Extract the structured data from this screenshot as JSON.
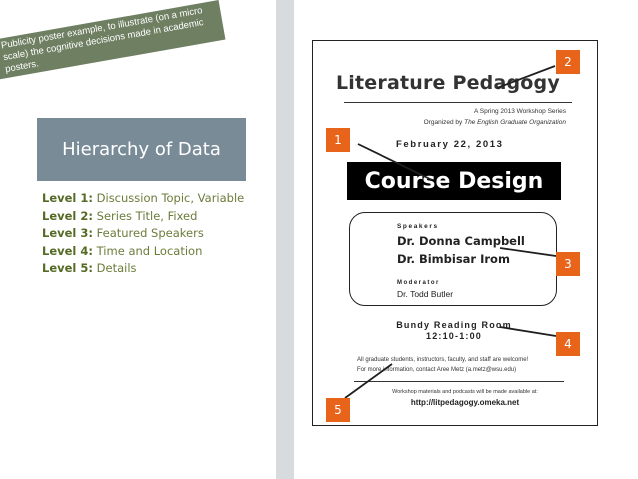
{
  "banner": {
    "text": "Publicity poster example, to illustrate (on a micro scale) the cognitive decisions made in academic posters."
  },
  "hierarchy": {
    "title": "Hierarchy of Data",
    "levels": [
      {
        "label": "Level 1:",
        "text": " Discussion Topic, Variable"
      },
      {
        "label": "Level 2:",
        "text": " Series Title, Fixed"
      },
      {
        "label": "Level 3:",
        "text": " Featured Speakers"
      },
      {
        "label": "Level 4:",
        "text": " Time and Location"
      },
      {
        "label": "Level 5:",
        "text": " Details"
      }
    ]
  },
  "poster": {
    "title": "Literature Pedagogy",
    "subtitle": "A Spring 2013 Workshop Series",
    "organized_prefix": "Organized by ",
    "organized_by": "The English Graduate Organization",
    "date": "February 22, 2013",
    "topic": "Course Design",
    "speakers_label": "Speakers",
    "speakers": [
      "Dr. Donna Campbell",
      "Dr. Bimbisar Irom"
    ],
    "moderator_label": "Moderator",
    "moderator": "Dr. Todd Butler",
    "venue": "Bundy Reading Room",
    "time": "12:10-1:00",
    "details_line1": "All graduate students, instructors, faculty, and staff are welcome!",
    "details_line2": "For more information, contact Aree Metz (a.metz@wsu.edu)",
    "materials": "Workshop materials and podcasts will be made available at:",
    "url": "http://litpedagogy.omeka.net"
  },
  "callouts": [
    "1",
    "2",
    "3",
    "4",
    "5"
  ],
  "colors": {
    "callout": "#e8641b",
    "hierarchy_box": "#7a8b98",
    "banner": "#6f7f62"
  }
}
